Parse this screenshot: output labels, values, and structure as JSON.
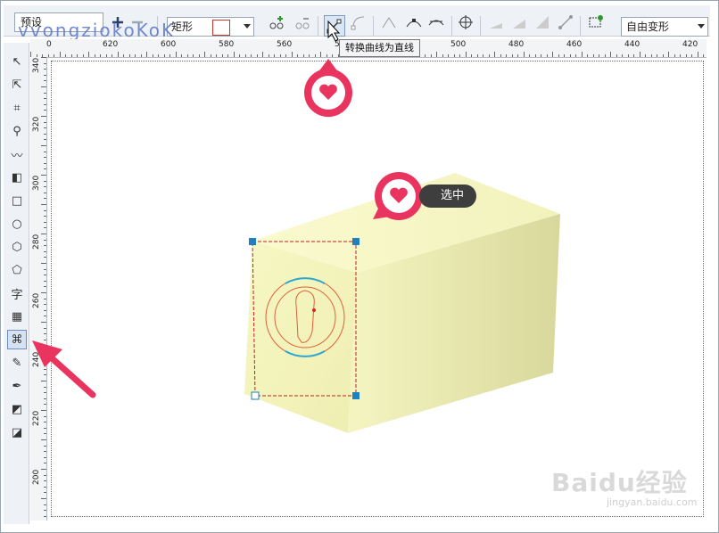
{
  "propbar": {
    "preset_label": "预设",
    "shape_select": "矩形",
    "transform_select": "自由变形"
  },
  "watermark_text": "vvongziokoKoK",
  "tooltip": "转换曲线为直线",
  "callout_label": "选中",
  "ruler": {
    "h_labels": [
      "0",
      "620",
      "600",
      "580",
      "560",
      "540",
      "520",
      "500",
      "480",
      "460",
      "440",
      "420"
    ],
    "v_labels": [
      "340",
      "320",
      "300",
      "280",
      "260",
      "240",
      "220",
      "200"
    ]
  },
  "tools": [
    {
      "name": "pick-tool-icon",
      "glyph": "↖"
    },
    {
      "name": "shape-tool-icon",
      "glyph": "⇱"
    },
    {
      "name": "crop-tool-icon",
      "glyph": "⌗"
    },
    {
      "name": "zoom-tool-icon",
      "glyph": "⚲"
    },
    {
      "name": "freehand-tool-icon",
      "glyph": "〰"
    },
    {
      "name": "smart-fill-tool-icon",
      "glyph": "◧"
    },
    {
      "name": "rectangle-tool-icon",
      "glyph": "□"
    },
    {
      "name": "ellipse-tool-icon",
      "glyph": "○"
    },
    {
      "name": "polygon-tool-icon",
      "glyph": "⬡"
    },
    {
      "name": "basic-shapes-tool-icon",
      "glyph": "⬠"
    },
    {
      "name": "text-tool-icon",
      "glyph": "字"
    },
    {
      "name": "table-tool-icon",
      "glyph": "▦"
    },
    {
      "name": "envelope-tool-icon",
      "glyph": "⌘"
    },
    {
      "name": "eyedropper-tool-icon",
      "glyph": "✎"
    },
    {
      "name": "outline-pen-tool-icon",
      "glyph": "✒"
    },
    {
      "name": "fill-tool-icon",
      "glyph": "◩"
    },
    {
      "name": "interactive-fill-tool-icon",
      "glyph": "◪"
    }
  ],
  "baidu_logo": "Baidu经验",
  "baidu_url": "jingyan.baidu.com",
  "colors": {
    "accent": "#e8345e",
    "box_light": "#fafac8",
    "box_dark": "#c9c98a",
    "selection_node": "#1f7fc0"
  }
}
